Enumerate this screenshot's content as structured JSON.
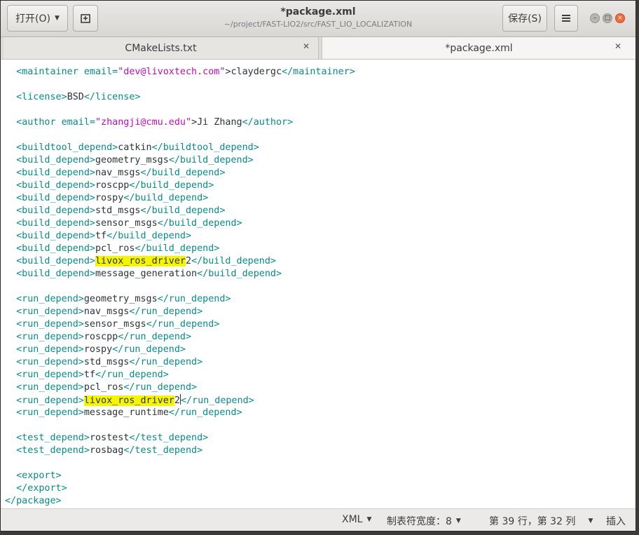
{
  "header": {
    "open_label": "打开(O)",
    "title": "*package.xml",
    "subtitle": "~/project/FAST-LIO2/src/FAST_LIO_LOCALIZATION",
    "save_label": "保存(S)"
  },
  "tabs": [
    {
      "label": "CMakeLists.txt",
      "active": false
    },
    {
      "label": "*package.xml",
      "active": true
    }
  ],
  "editor": {
    "lines": [
      [
        [
          "t",
          "  <maintainer "
        ],
        [
          "a",
          "email="
        ],
        [
          "v",
          "\"dev@livoxtech.com\""
        ],
        [
          "x",
          ">claydergc"
        ],
        [
          "t",
          "</maintainer>"
        ]
      ],
      [],
      [
        [
          "t",
          "  <license>"
        ],
        [
          "x",
          "BSD"
        ],
        [
          "t",
          "</license>"
        ]
      ],
      [],
      [
        [
          "t",
          "  <author "
        ],
        [
          "a",
          "email="
        ],
        [
          "v",
          "\"zhangji@cmu.edu\""
        ],
        [
          "x",
          ">Ji Zhang"
        ],
        [
          "t",
          "</author>"
        ]
      ],
      [],
      [
        [
          "t",
          "  <buildtool_depend>"
        ],
        [
          "x",
          "catkin"
        ],
        [
          "t",
          "</buildtool_depend>"
        ]
      ],
      [
        [
          "t",
          "  <build_depend>"
        ],
        [
          "x",
          "geometry_msgs"
        ],
        [
          "t",
          "</build_depend>"
        ]
      ],
      [
        [
          "t",
          "  <build_depend>"
        ],
        [
          "x",
          "nav_msgs"
        ],
        [
          "t",
          "</build_depend>"
        ]
      ],
      [
        [
          "t",
          "  <build_depend>"
        ],
        [
          "x",
          "roscpp"
        ],
        [
          "t",
          "</build_depend>"
        ]
      ],
      [
        [
          "t",
          "  <build_depend>"
        ],
        [
          "x",
          "rospy"
        ],
        [
          "t",
          "</build_depend>"
        ]
      ],
      [
        [
          "t",
          "  <build_depend>"
        ],
        [
          "x",
          "std_msgs"
        ],
        [
          "t",
          "</build_depend>"
        ]
      ],
      [
        [
          "t",
          "  <build_depend>"
        ],
        [
          "x",
          "sensor_msgs"
        ],
        [
          "t",
          "</build_depend>"
        ]
      ],
      [
        [
          "t",
          "  <build_depend>"
        ],
        [
          "x",
          "tf"
        ],
        [
          "t",
          "</build_depend>"
        ]
      ],
      [
        [
          "t",
          "  <build_depend>"
        ],
        [
          "x",
          "pcl_ros"
        ],
        [
          "t",
          "</build_depend>"
        ]
      ],
      [
        [
          "t",
          "  <build_depend>"
        ],
        [
          "h",
          "livox_ros_driver"
        ],
        [
          "x",
          "2"
        ],
        [
          "t",
          "</build_depend>"
        ]
      ],
      [
        [
          "t",
          "  <build_depend>"
        ],
        [
          "x",
          "message_generation"
        ],
        [
          "t",
          "</build_depend>"
        ]
      ],
      [],
      [
        [
          "t",
          "  <run_depend>"
        ],
        [
          "x",
          "geometry_msgs"
        ],
        [
          "t",
          "</run_depend>"
        ]
      ],
      [
        [
          "t",
          "  <run_depend>"
        ],
        [
          "x",
          "nav_msgs"
        ],
        [
          "t",
          "</run_depend>"
        ]
      ],
      [
        [
          "t",
          "  <run_depend>"
        ],
        [
          "x",
          "sensor_msgs"
        ],
        [
          "t",
          "</run_depend>"
        ]
      ],
      [
        [
          "t",
          "  <run_depend>"
        ],
        [
          "x",
          "roscpp"
        ],
        [
          "t",
          "</run_depend>"
        ]
      ],
      [
        [
          "t",
          "  <run_depend>"
        ],
        [
          "x",
          "rospy"
        ],
        [
          "t",
          "</run_depend>"
        ]
      ],
      [
        [
          "t",
          "  <run_depend>"
        ],
        [
          "x",
          "std_msgs"
        ],
        [
          "t",
          "</run_depend>"
        ]
      ],
      [
        [
          "t",
          "  <run_depend>"
        ],
        [
          "x",
          "tf"
        ],
        [
          "t",
          "</run_depend>"
        ]
      ],
      [
        [
          "t",
          "  <run_depend>"
        ],
        [
          "x",
          "pcl_ros"
        ],
        [
          "t",
          "</run_depend>"
        ]
      ],
      [
        [
          "t",
          "  <run_depend>"
        ],
        [
          "h",
          "livox_ros_driver"
        ],
        [
          "x",
          "2"
        ],
        [
          "c",
          ""
        ],
        [
          "t",
          "</run_depend>"
        ]
      ],
      [
        [
          "t",
          "  <run_depend>"
        ],
        [
          "x",
          "message_runtime"
        ],
        [
          "t",
          "</run_depend>"
        ]
      ],
      [],
      [
        [
          "t",
          "  <test_depend>"
        ],
        [
          "x",
          "rostest"
        ],
        [
          "t",
          "</test_depend>"
        ]
      ],
      [
        [
          "t",
          "  <test_depend>"
        ],
        [
          "x",
          "rosbag"
        ],
        [
          "t",
          "</test_depend>"
        ]
      ],
      [],
      [
        [
          "t",
          "  <export>"
        ]
      ],
      [
        [
          "t",
          "  </export>"
        ]
      ],
      [
        [
          "t",
          "</package>"
        ]
      ]
    ]
  },
  "statusbar": {
    "language": "XML",
    "tab_width": "制表符宽度：8",
    "position": "第 39 行，第 32 列",
    "mode": "插入"
  }
}
